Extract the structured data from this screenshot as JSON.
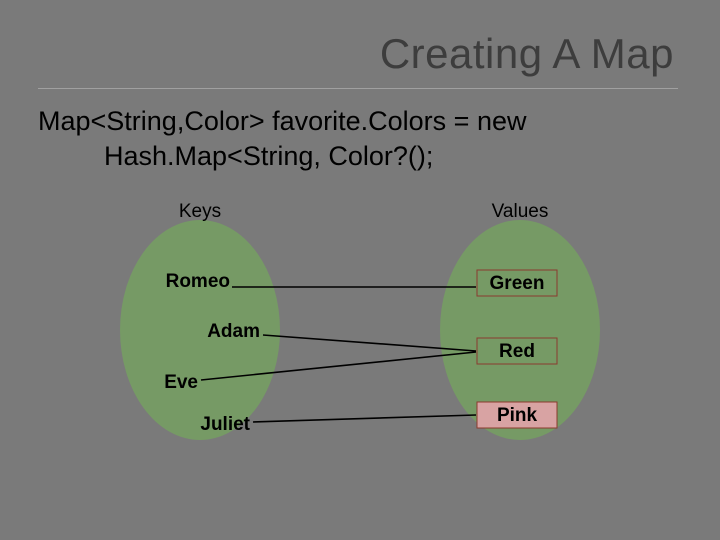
{
  "title": "Creating A Map",
  "code": {
    "line1": "Map<String,Color> favorite.Colors = new",
    "line2": "Hash.Map<String, Color?();"
  },
  "diagram": {
    "keys_header": "Keys",
    "values_header": "Values",
    "keys": [
      "Romeo",
      "Adam",
      "Eve",
      "Juliet"
    ],
    "values": [
      "Green",
      "Red",
      "Pink"
    ],
    "mappings": [
      {
        "from": "Romeo",
        "to": "Green"
      },
      {
        "from": "Adam",
        "to": "Red"
      },
      {
        "from": "Eve",
        "to": "Red"
      },
      {
        "from": "Juliet",
        "to": "Pink"
      }
    ]
  }
}
